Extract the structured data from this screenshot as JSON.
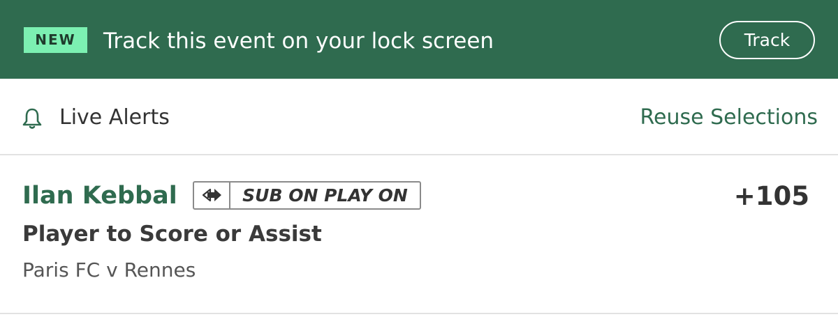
{
  "banner": {
    "badge": "NEW",
    "message": "Track this event on your lock screen",
    "track_label": "Track",
    "background_color": "#2f6b4f",
    "badge_color": "#7cf0b2"
  },
  "alerts": {
    "label": "Live Alerts",
    "icon": "bell-icon",
    "reuse_label": "Reuse Selections"
  },
  "selection": {
    "player": "Ilan Kebbal",
    "badge_icon": "sub-on-arrow-icon",
    "badge_label": "SUB ON PLAY ON",
    "odds": "+105",
    "market": "Player to Score or Assist",
    "event": "Paris FC v Rennes"
  }
}
